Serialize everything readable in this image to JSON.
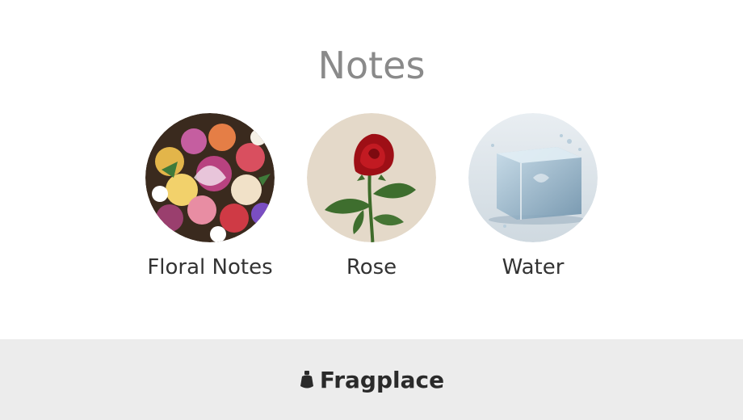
{
  "title": "Notes",
  "notes": [
    {
      "label": "Floral Notes",
      "icon": "floral-bouquet-image"
    },
    {
      "label": "Rose",
      "icon": "red-rose-image"
    },
    {
      "label": "Water",
      "icon": "ice-cube-splash-image"
    }
  ],
  "footer": {
    "brand": "Fragplace",
    "logo_icon": "perfume-bottle-icon"
  },
  "colors": {
    "title": "#8a8a8a",
    "label": "#333333",
    "footer_bg": "#ececec",
    "brand": "#2a2a2a"
  }
}
